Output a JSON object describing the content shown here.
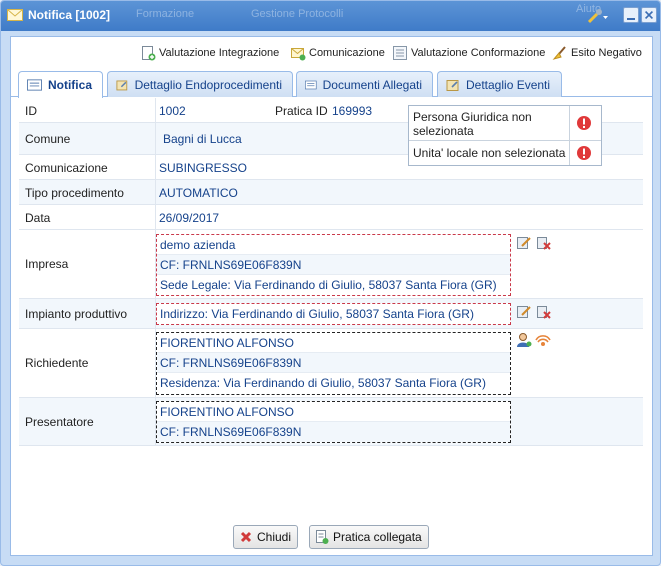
{
  "window": {
    "title": "Notifica [1002]",
    "ghost_menu": [
      "Formazione",
      "Gestione Protocolli",
      "Aiuto"
    ]
  },
  "toolbar": {
    "valutazione_integrazione": "Valutazione Integrazione",
    "comunicazione": "Comunicazione",
    "valutazione_conformazione": "Valutazione Conformazione",
    "esito_negativo": "Esito Negativo"
  },
  "tabs": [
    {
      "label": "Notifica",
      "active": true
    },
    {
      "label": "Dettaglio Endoprocedimenti",
      "active": false
    },
    {
      "label": "Documenti Allegati",
      "active": false
    },
    {
      "label": "Dettaglio Eventi",
      "active": false
    }
  ],
  "fields": {
    "id": {
      "label": "ID",
      "value": "1002"
    },
    "pratica": {
      "label": "Pratica ID",
      "value": "169993"
    },
    "comune": {
      "label": "Comune",
      "value": "Bagni di Lucca"
    },
    "comunicazione": {
      "label": "Comunicazione",
      "value": "SUBINGRESSO"
    },
    "tipo": {
      "label": "Tipo procedimento",
      "value": "AUTOMATICO"
    },
    "data": {
      "label": "Data",
      "value": "26/09/2017"
    },
    "impresa": {
      "label": "Impresa",
      "lines": [
        "demo azienda",
        "CF: FRNLNS69E06F839N",
        "Sede Legale: Via Ferdinando di Giulio, 58037 Santa Fiora (GR)"
      ]
    },
    "impianto": {
      "label": "Impianto produttivo",
      "lines": [
        "Indirizzo: Via Ferdinando di Giulio, 58037 Santa Fiora (GR)"
      ]
    },
    "richiedente": {
      "label": "Richiedente",
      "lines": [
        "FIORENTINO ALFONSO",
        "CF: FRNLNS69E06F839N",
        "Residenza: Via Ferdinando di Giulio, 58037 Santa Fiora (GR)"
      ]
    },
    "presentatore": {
      "label": "Presentatore",
      "lines": [
        "FIORENTINO ALFONSO",
        "CF: FRNLNS69E06F839N"
      ]
    }
  },
  "alerts": [
    {
      "text": "Persona Giuridica non selezionata",
      "icon": "error-icon"
    },
    {
      "text": "Unita' locale non selezionata",
      "icon": "error-icon"
    }
  ],
  "buttons": {
    "chiudi": "Chiudi",
    "pratica_collegata": "Pratica collegata"
  },
  "colors": {
    "titlebar": "#4a86cf",
    "link_text": "#15428b",
    "error_red": "#e0393a",
    "dashed_red": "#c9394a"
  }
}
